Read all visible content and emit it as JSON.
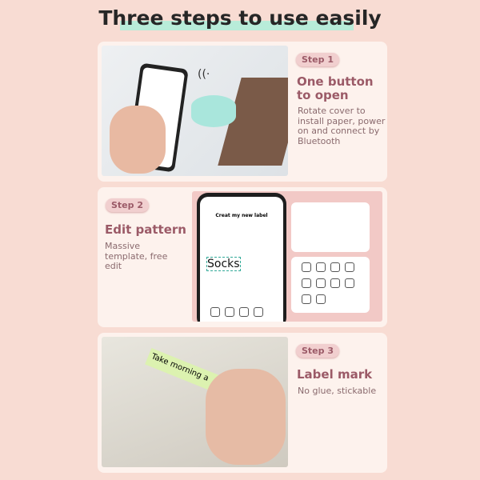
{
  "title": "Three steps to use easily",
  "steps": [
    {
      "badge": "Step 1",
      "heading": "One button to open",
      "desc": "Rotate cover to install paper, power on and connect by Bluetooth"
    },
    {
      "badge": "Step 2",
      "heading": "Edit pattern",
      "desc": "Massive template, free edit",
      "app_title": "Creat my new label",
      "label_text": "Socks"
    },
    {
      "badge": "Step 3",
      "heading": "Label mark",
      "desc": "No glue, stickable",
      "label_text": "Take morning a"
    }
  ]
}
